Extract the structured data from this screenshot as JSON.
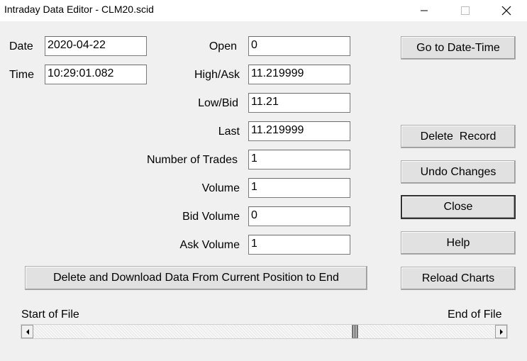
{
  "window": {
    "title": "Intraday Data Editor - CLM20.scid",
    "minimize_icon": "minimize-icon",
    "maximize_icon": "maximize-icon",
    "close_icon": "close-icon"
  },
  "fields": {
    "date": {
      "label": "Date",
      "value": "2020-04-22"
    },
    "time": {
      "label": "Time",
      "value": "10:29:01.082"
    },
    "open": {
      "label": "Open",
      "value": "0"
    },
    "high_ask": {
      "label": "High/Ask",
      "value": "11.219999"
    },
    "low_bid": {
      "label": "Low/Bid",
      "value": "11.21"
    },
    "last": {
      "label": "Last",
      "value": "11.219999"
    },
    "number_of_trades": {
      "label": "Number of Trades",
      "value": "1"
    },
    "volume": {
      "label": "Volume",
      "value": "1"
    },
    "bid_volume": {
      "label": "Bid Volume",
      "value": "0"
    },
    "ask_volume": {
      "label": "Ask Volume",
      "value": "1"
    }
  },
  "buttons": {
    "go_to_date_time": "Go to Date-Time",
    "delete_record": "Delete  Record",
    "undo_changes": "Undo Changes",
    "close": "Close",
    "help": "Help",
    "reload_charts": "Reload Charts",
    "delete_and_download": "Delete and Download Data From Current Position to End"
  },
  "scroll": {
    "start_label": "Start of File",
    "end_label": "End of File",
    "position_fraction": 0.7
  }
}
